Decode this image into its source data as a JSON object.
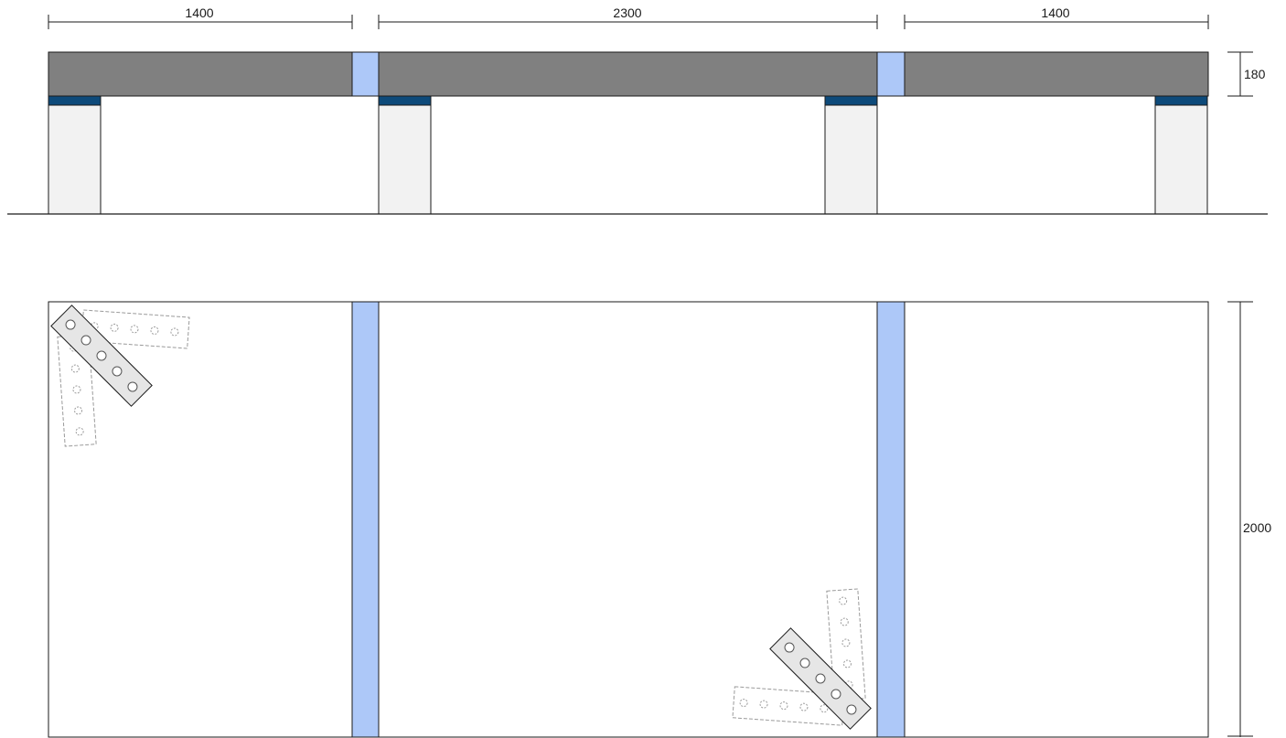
{
  "elevation": {
    "dimensions": {
      "span_left": "1400",
      "span_middle": "2300",
      "span_right": "1400",
      "slab_thickness": "180"
    }
  },
  "plan": {
    "dimensions": {
      "slab_width": "2000"
    }
  },
  "colors": {
    "slab": "#808080",
    "joint": "#adc8f8",
    "bearing": "#0d4a7a",
    "support": "#f2f2f2",
    "outline": "#1a1a1a",
    "plate": "#e6e6e6",
    "plate_dashed": "#9a9a9a"
  }
}
